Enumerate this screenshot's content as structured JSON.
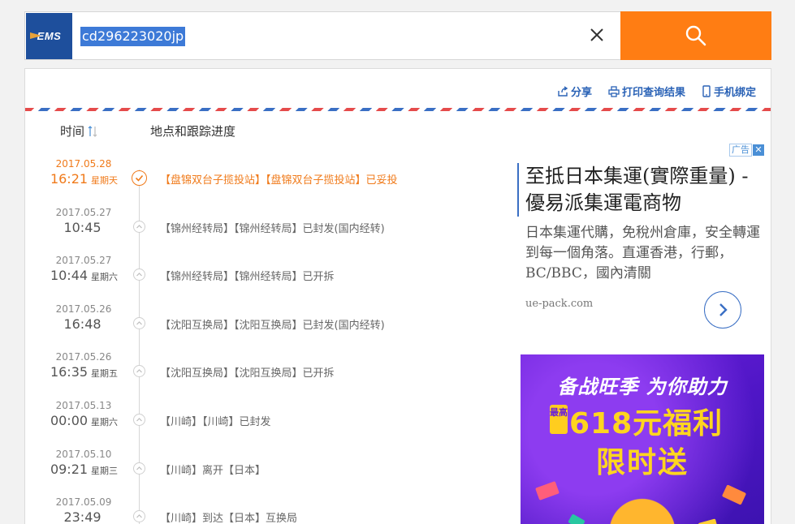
{
  "search": {
    "logo": "EMS",
    "value": "cd296223020jp",
    "clear_icon": "close-icon",
    "search_icon": "search-icon"
  },
  "actions": [
    {
      "label": "分享",
      "icon": "share-icon"
    },
    {
      "label": "打印查询结果",
      "icon": "printer-icon"
    },
    {
      "label": "手机绑定",
      "icon": "phone-icon"
    }
  ],
  "columns": {
    "time": "时间",
    "place": "地点和跟踪进度"
  },
  "events": [
    {
      "date": "2017.05.28",
      "time": "16:21",
      "weekday": "星期天",
      "desc": "【盘锦双台子揽投站】【盘锦双台子揽投站】已妥投",
      "latest": true
    },
    {
      "date": "2017.05.27",
      "time": "10:45",
      "weekday": "",
      "desc": "【锦州经转局】【锦州经转局】已封发(国内经转)"
    },
    {
      "date": "2017.05.27",
      "time": "10:44",
      "weekday": "星期六",
      "desc": "【锦州经转局】【锦州经转局】已开拆"
    },
    {
      "date": "2017.05.26",
      "time": "16:48",
      "weekday": "",
      "desc": "【沈阳互换局】【沈阳互换局】已封发(国内经转)"
    },
    {
      "date": "2017.05.26",
      "time": "16:35",
      "weekday": "星期五",
      "desc": "【沈阳互换局】【沈阳互换局】已开拆"
    },
    {
      "date": "2017.05.13",
      "time": "00:00",
      "weekday": "星期六",
      "desc": "【川崎】【川崎】已封发"
    },
    {
      "date": "2017.05.10",
      "time": "09:21",
      "weekday": "星期三",
      "desc": "【川崎】离开【日本】"
    },
    {
      "date": "2017.05.09",
      "time": "23:49",
      "weekday": "",
      "desc": "【川崎】到达【日本】互换局"
    }
  ],
  "ad_text": {
    "badge": "广告",
    "title": "至抵日本集運(實際重量) - 優易派集運電商物",
    "desc": "日本集運代購，免稅州倉庫，安全轉運到每一個角落。直運香港，行郵，BC/BBC，國內清關",
    "domain": "ue-pack.com"
  },
  "ad_banner": {
    "line1": "备战旺季 为你助力",
    "badge": "最高",
    "line2": "618元福利",
    "line3": "限时送"
  },
  "colors": {
    "accent": "#ff7d13",
    "link": "#2a62b6",
    "ems_blue": "#1e4f9c"
  }
}
